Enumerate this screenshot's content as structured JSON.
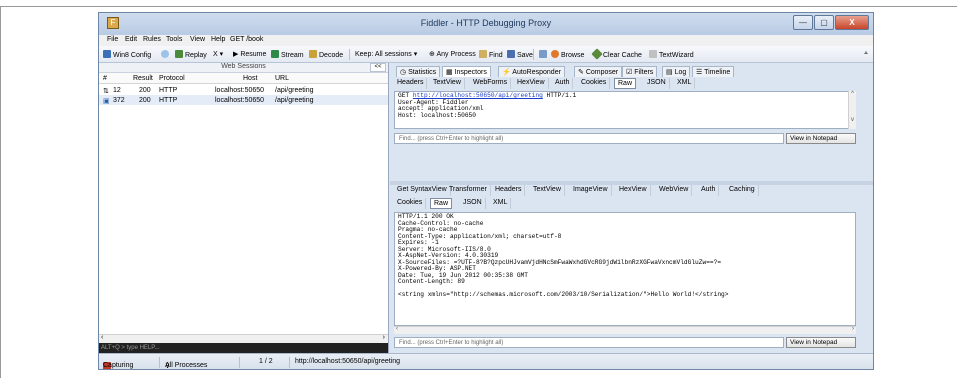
{
  "window": {
    "title": "Fiddler - HTTP Debugging Proxy",
    "controls": {
      "minimize": "—",
      "maximize": "▢",
      "close": "X"
    }
  },
  "menu": [
    "File",
    "Edit",
    "Rules",
    "Tools",
    "View",
    "Help",
    "GET /book"
  ],
  "toolbar": {
    "win8_config": "Win8 Config",
    "replay": "Replay",
    "remove": "X",
    "resume": "Resume",
    "stream": "Stream",
    "decode": "Decode",
    "keep": "Keep: All sessions",
    "any_process": "Any Process",
    "find": "Find",
    "save": "Save",
    "browse": "Browse",
    "clear_cache": "Clear Cache",
    "textwizard": "TextWizard"
  },
  "sessions": {
    "header": "Web Sessions",
    "collapse": "<<",
    "columns": [
      "#",
      "Result",
      "Protocol",
      "Host",
      "URL"
    ],
    "rows": [
      {
        "id": "12",
        "result": "200",
        "protocol": "HTTP",
        "host": "localhost:50650",
        "url": "/api/greeting"
      },
      {
        "id": "372",
        "result": "200",
        "protocol": "HTTP",
        "host": "localhost:50650",
        "url": "/api/greeting"
      }
    ],
    "quickexec_placeholder": "ALT+Q > type HELP..."
  },
  "main_tabs": [
    "Statistics",
    "Inspectors",
    "AutoResponder",
    "Composer",
    "Filters",
    "Log",
    "Timeline"
  ],
  "request": {
    "tabs": [
      "Headers",
      "TextView",
      "WebForms",
      "HexView",
      "Auth",
      "Cookies",
      "Raw",
      "JSON",
      "XML"
    ],
    "active_tab": "Raw",
    "line1_method": "GET ",
    "line1_url": "http://localhost:50650/api/greeting",
    "line1_proto": " HTTP/1.1",
    "rest": "User-Agent: Fiddler\naccept: application/xml\nHost: localhost:50650",
    "find_placeholder": "Find... (press Ctrl+Enter to highlight all)",
    "notepad": "View in Notepad"
  },
  "response": {
    "tabs_row1": [
      "Get SyntaxView",
      "Transformer",
      "Headers",
      "TextView",
      "ImageView",
      "HexView",
      "WebView",
      "Auth",
      "Caching"
    ],
    "tabs_row2": [
      "Cookies",
      "Raw",
      "JSON",
      "XML"
    ],
    "active_tab": "Raw",
    "body": "HTTP/1.1 200 OK\nCache-Control: no-cache\nPragma: no-cache\nContent-Type: application/xml; charset=utf-8\nExpires: -1\nServer: Microsoft-IIS/8.0\nX-AspNet-Version: 4.0.30319\nX-SourceFiles: =?UTF-8?B?QzpcUHJvamVjdHNcSmFwaWxhdGVcRG9jdW1lbnRzXGFwaVxncmVldGluZw==?=\nX-Powered-By: ASP.NET\nDate: Tue, 19 Jun 2012 00:35:38 GMT\nContent-Length: 89\n\n<string xmlns=\"http://schemas.microsoft.com/2003/10/Serialization/\">Hello World!</string>",
    "find_placeholder": "Find... (press Ctrl+Enter to highlight all)",
    "notepad": "View in Notepad"
  },
  "status": {
    "capturing": "Capturing",
    "processes": "All Processes",
    "count": "1 / 2",
    "url": "http://localhost:50650/api/greeting"
  }
}
